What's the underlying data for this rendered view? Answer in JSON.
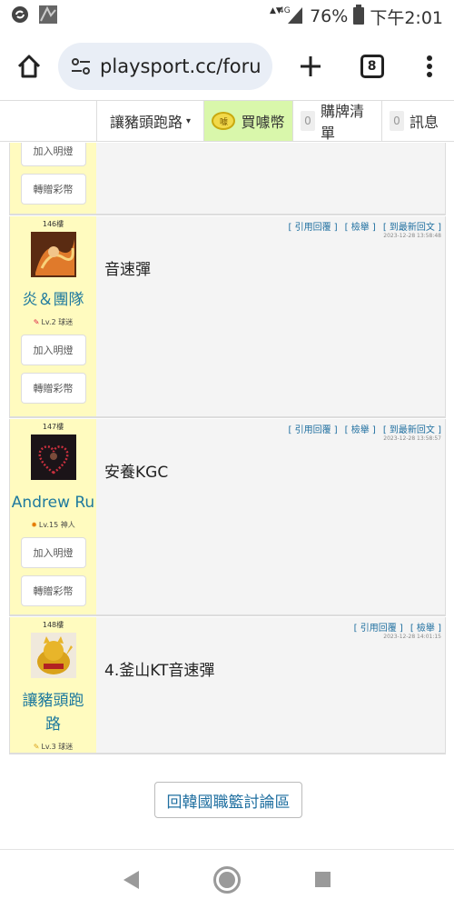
{
  "status": {
    "network": "4G",
    "battery": "76%",
    "time": "下午2:01"
  },
  "browser": {
    "url": "playsport.cc/foru",
    "tab_count": "8"
  },
  "nav": {
    "user": "讓豬頭跑路",
    "coin": "買噱幣",
    "coin_icon": "噱",
    "cart_count": "0",
    "cart": "購牌清單",
    "msg_count": "0",
    "msg": "訊息"
  },
  "partial_post": {
    "btn_light": "加入明燈",
    "btn_gift": "轉贈彩幣"
  },
  "posts": [
    {
      "floor": "146樓",
      "user": "炎＆團隊",
      "level": "Lv.2 球迷",
      "btn_light": "加入明燈",
      "btn_gift": "轉贈彩幣",
      "act_quote": "[ 引用回覆 ]",
      "act_report": "[ 檢舉 ]",
      "act_latest": "[ 到最新回文 ]",
      "time": "2023-12-28 13:58:48",
      "content": "音速彈"
    },
    {
      "floor": "147樓",
      "user": "Andrew Ru",
      "level": "Lv.15 神人",
      "btn_light": "加入明燈",
      "btn_gift": "轉贈彩幣",
      "act_quote": "[ 引用回覆 ]",
      "act_report": "[ 檢舉 ]",
      "act_latest": "[ 到最新回文 ]",
      "time": "2023-12-28 13:58:57",
      "content": "安養KGC"
    },
    {
      "floor": "148樓",
      "user": "讓豬頭跑路",
      "level": "Lv.3 球迷",
      "act_quote": "[ 引用回覆 ]",
      "act_report": "[ 檢舉 ]",
      "time": "2023-12-28 14:01:15",
      "content": "4.釜山KT音速彈"
    }
  ],
  "back_button": "回韓國職籃討論區"
}
